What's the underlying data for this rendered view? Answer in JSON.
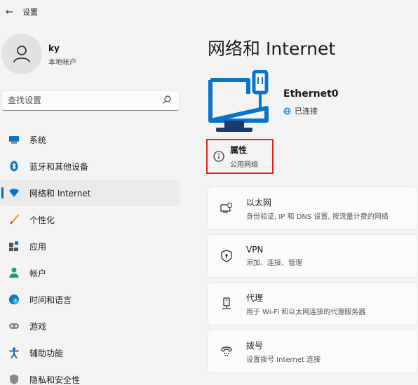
{
  "window": {
    "title": "设置"
  },
  "profile": {
    "name": "ky",
    "account_type": "本地帐户"
  },
  "search": {
    "placeholder": "查找设置"
  },
  "nav": {
    "items": [
      {
        "label": "系统",
        "icon": "monitor-icon"
      },
      {
        "label": "蓝牙和其他设备",
        "icon": "bluetooth-icon"
      },
      {
        "label": "网络和 Internet",
        "icon": "wifi-icon",
        "active": true
      },
      {
        "label": "个性化",
        "icon": "brush-icon"
      },
      {
        "label": "应用",
        "icon": "apps-icon"
      },
      {
        "label": "帐户",
        "icon": "person-icon"
      },
      {
        "label": "时间和语言",
        "icon": "globe-clock-icon"
      },
      {
        "label": "游戏",
        "icon": "gamepad-icon"
      },
      {
        "label": "辅助功能",
        "icon": "accessibility-icon"
      },
      {
        "label": "隐私和安全性",
        "icon": "shield-icon"
      }
    ]
  },
  "main": {
    "title": "网络和 Internet",
    "device": {
      "name": "Ethernet0",
      "status": "已连接"
    },
    "properties": {
      "title": "属性",
      "subtitle": "公用网络"
    },
    "cards": [
      {
        "title": "以太网",
        "subtitle": "身份验证, IP 和 DNS 设置, 按流量计费的网络",
        "icon": "ethernet-icon"
      },
      {
        "title": "VPN",
        "subtitle": "添加、连接、管理",
        "icon": "vpn-shield-icon"
      },
      {
        "title": "代理",
        "subtitle": "用于 Wi-Fi 和以太网连接的代理服务器",
        "icon": "proxy-icon"
      },
      {
        "title": "拨号",
        "subtitle": "设置拨号 Internet 连接",
        "icon": "dialup-icon"
      }
    ]
  },
  "colors": {
    "accent": "#0067c0",
    "highlight_border": "#e0211f",
    "status_green": "#0f7b0f"
  }
}
